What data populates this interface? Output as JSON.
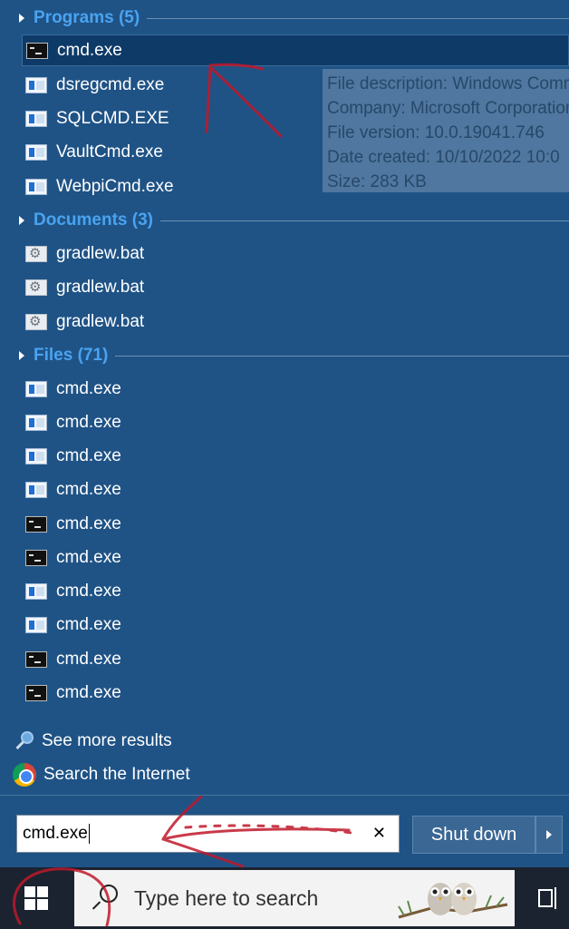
{
  "sections": {
    "programs": {
      "title": "Programs (5)",
      "items": [
        {
          "label": "cmd.exe",
          "icon": "cmd-icon",
          "selected": true
        },
        {
          "label": "dsregcmd.exe",
          "icon": "app-window-icon"
        },
        {
          "label": "SQLCMD.EXE",
          "icon": "app-window-icon"
        },
        {
          "label": "VaultCmd.exe",
          "icon": "app-window-icon"
        },
        {
          "label": "WebpiCmd.exe",
          "icon": "app-window-icon"
        }
      ]
    },
    "documents": {
      "title": "Documents (3)",
      "items": [
        {
          "label": "gradlew.bat",
          "icon": "batch-file-icon"
        },
        {
          "label": "gradlew.bat",
          "icon": "batch-file-icon"
        },
        {
          "label": "gradlew.bat",
          "icon": "batch-file-icon"
        }
      ]
    },
    "files": {
      "title": "Files (71)",
      "items": [
        {
          "label": "cmd.exe",
          "icon": "app-window-icon"
        },
        {
          "label": "cmd.exe",
          "icon": "app-window-icon"
        },
        {
          "label": "cmd.exe",
          "icon": "app-window-icon"
        },
        {
          "label": "cmd.exe",
          "icon": "app-window-icon"
        },
        {
          "label": "cmd.exe",
          "icon": "cmd-icon"
        },
        {
          "label": "cmd.exe",
          "icon": "cmd-icon"
        },
        {
          "label": "cmd.exe",
          "icon": "app-window-icon"
        },
        {
          "label": "cmd.exe",
          "icon": "app-window-icon"
        },
        {
          "label": "cmd.exe",
          "icon": "cmd-icon"
        },
        {
          "label": "cmd.exe",
          "icon": "cmd-icon"
        }
      ]
    }
  },
  "tooltip": {
    "description": "File description: Windows Command Processor",
    "company": "Company: Microsoft Corporation",
    "version": "File version: 10.0.19041.746",
    "date": "Date created: 10/10/2022 10:0",
    "size": "Size: 283 KB"
  },
  "extras": {
    "see_more": "See more results",
    "search_internet": "Search the Internet"
  },
  "search_box": {
    "value": "cmd.exe"
  },
  "shutdown": {
    "label": "Shut down"
  },
  "taskbar": {
    "search_placeholder": "Type here to search"
  },
  "colors": {
    "menu_bg": "#1f5487",
    "section_title": "#4aa3f0",
    "selected_bg": "#0e3a68",
    "annotation": "#c0182a"
  }
}
